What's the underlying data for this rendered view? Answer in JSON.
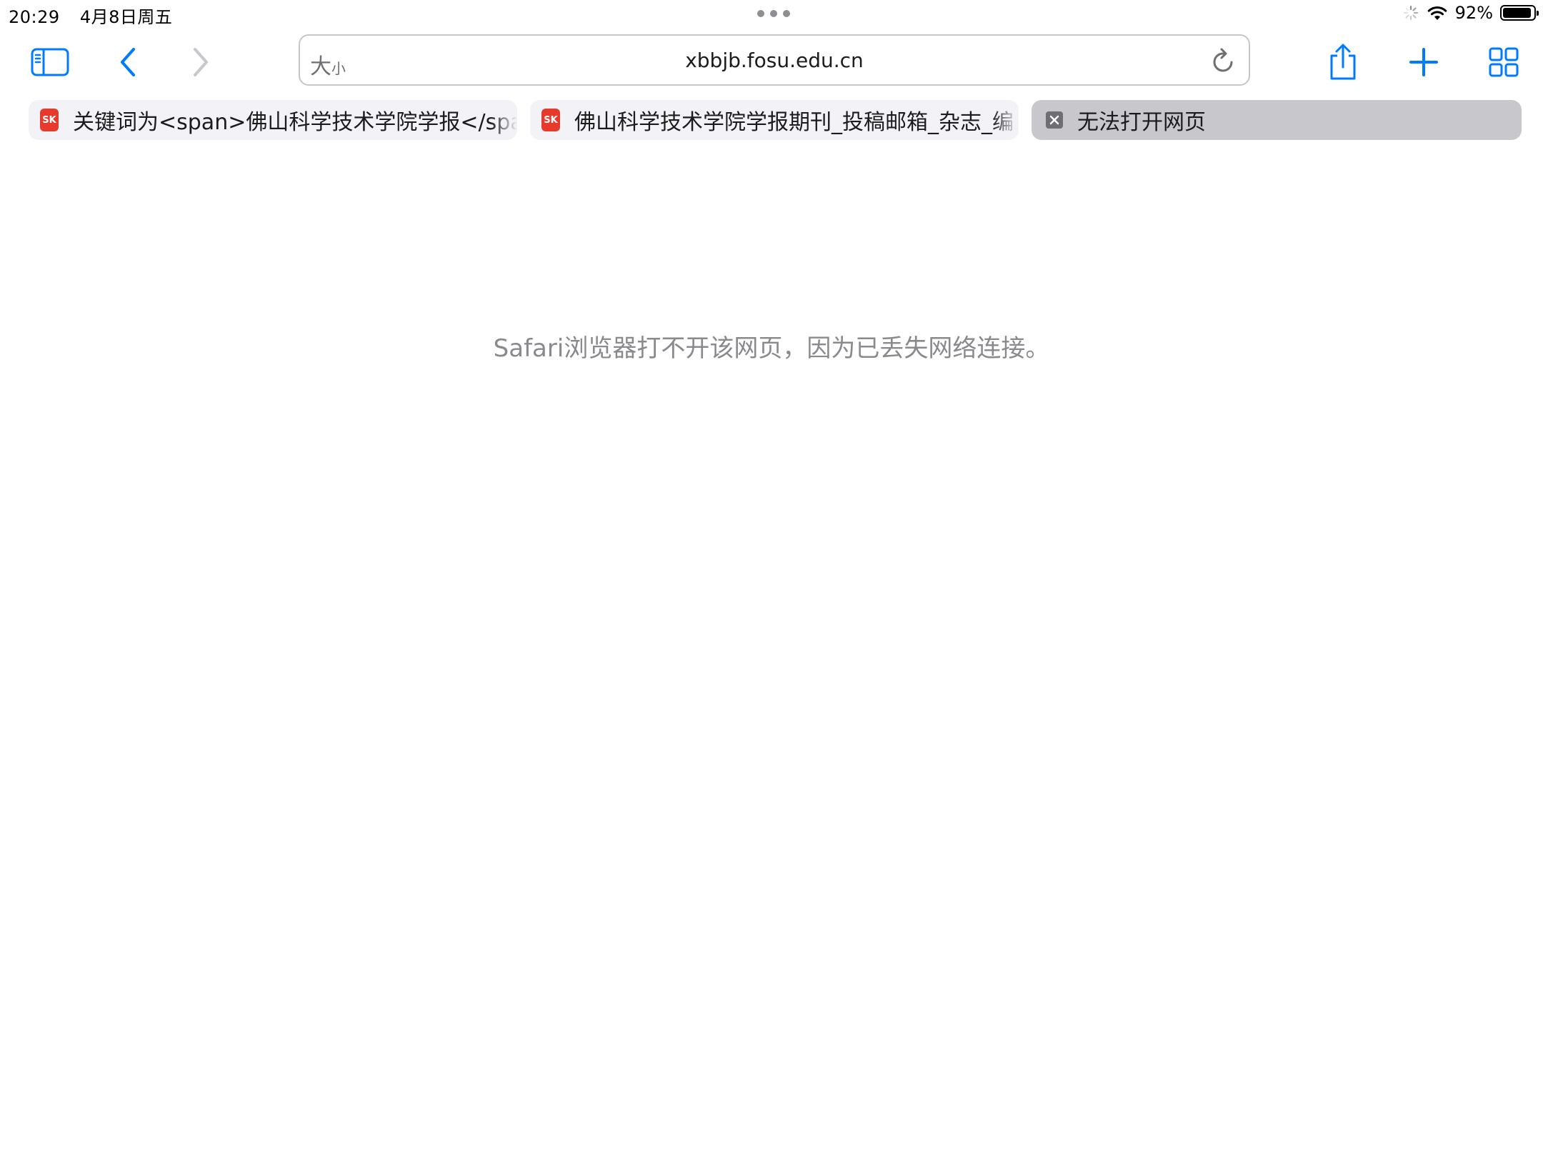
{
  "status_bar": {
    "time": "20:29",
    "date": "4月8日周五",
    "battery_percent": "92%",
    "battery_level": 0.92
  },
  "toolbar": {
    "text_size_big": "大",
    "text_size_small": "小",
    "url": "xbbjb.fosu.edu.cn",
    "icons": {
      "sidebar": "sidebar-icon",
      "back": "chevron-left-icon",
      "forward": "chevron-right-icon",
      "reload": "reload-icon",
      "share": "share-icon",
      "new_tab": "plus-icon",
      "tab_overview": "grid-icon"
    }
  },
  "tabs": [
    {
      "favicon": "SK",
      "title": "关键词为<span>佛山科学技术学院学报</span>",
      "active": false
    },
    {
      "favicon": "SK",
      "title": "佛山科学技术学院学报期刊_投稿邮箱_杂志_编",
      "active": false
    },
    {
      "title": "无法打开网页",
      "active": true
    }
  ],
  "content": {
    "error_message": "Safari浏览器打不开该网页，因为已丢失网络连接。"
  },
  "colors": {
    "accent": "#007aff",
    "tab_inactive": "#f2f2f7",
    "tab_active": "#c7c7cc",
    "error_text": "#8a8a8e"
  }
}
